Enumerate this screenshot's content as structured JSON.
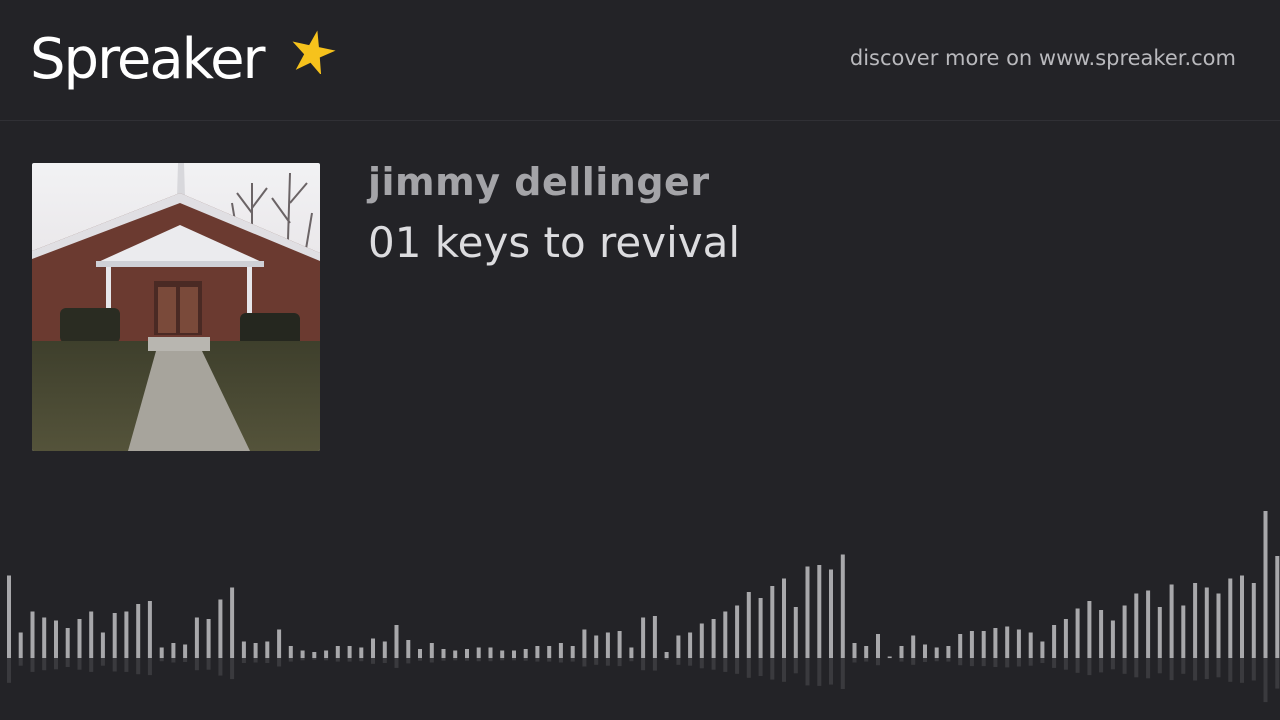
{
  "header": {
    "logo_text": "Spreaker",
    "discover_text": "discover more on www.spreaker.com"
  },
  "episode": {
    "author": "jimmy dellinger",
    "title": "01 keys to revival"
  },
  "cover": {
    "description_icon": "church-photo"
  },
  "waveform": {
    "bar_color": "#a8a8ab",
    "levels": [
      0.55,
      0.17,
      0.31,
      0.27,
      0.25,
      0.2,
      0.26,
      0.31,
      0.17,
      0.3,
      0.31,
      0.36,
      0.38,
      0.07,
      0.1,
      0.09,
      0.27,
      0.26,
      0.39,
      0.47,
      0.11,
      0.1,
      0.11,
      0.19,
      0.08,
      0.05,
      0.04,
      0.05,
      0.08,
      0.08,
      0.07,
      0.13,
      0.11,
      0.22,
      0.12,
      0.06,
      0.1,
      0.06,
      0.05,
      0.06,
      0.07,
      0.07,
      0.05,
      0.05,
      0.06,
      0.08,
      0.08,
      0.1,
      0.08,
      0.19,
      0.15,
      0.17,
      0.18,
      0.07,
      0.27,
      0.28,
      0.04,
      0.15,
      0.17,
      0.23,
      0.26,
      0.31,
      0.35,
      0.44,
      0.4,
      0.48,
      0.53,
      0.34,
      0.61,
      0.62,
      0.59,
      0.69,
      0.1,
      0.08,
      0.16,
      0.01,
      0.08,
      0.15,
      0.09,
      0.07,
      0.08,
      0.16,
      0.18,
      0.18,
      0.2,
      0.21,
      0.19,
      0.17,
      0.11,
      0.22,
      0.26,
      0.33,
      0.38,
      0.32,
      0.25,
      0.35,
      0.43,
      0.45,
      0.34,
      0.49,
      0.35,
      0.5,
      0.47,
      0.43,
      0.53,
      0.55,
      0.5,
      0.98,
      0.68
    ]
  }
}
